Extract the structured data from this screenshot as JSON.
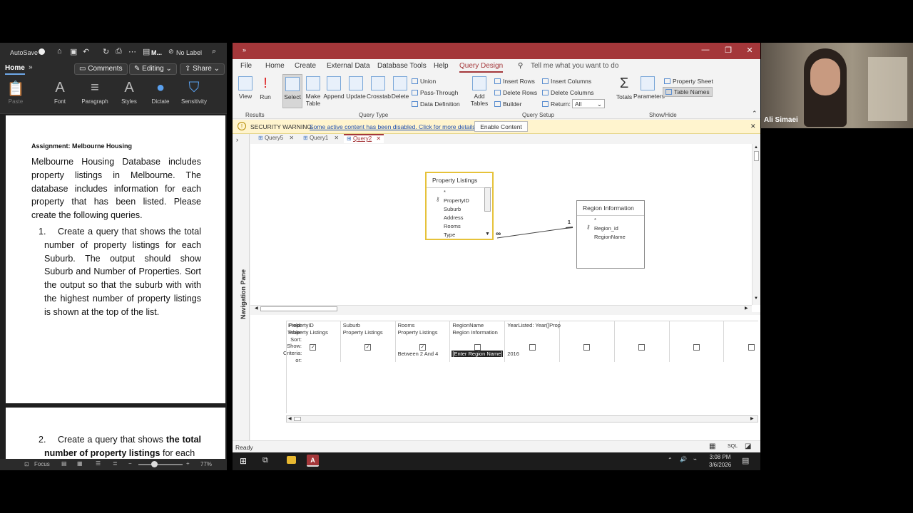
{
  "word": {
    "autosave": "AutoSave",
    "doc_short": "M...",
    "no_label": "No Label",
    "tab_home": "Home",
    "comments": "Comments",
    "editing": "Editing",
    "share": "Share",
    "ribbon": [
      "Paste",
      "Font",
      "Paragraph",
      "Styles",
      "Dictate",
      "Sensitivity"
    ],
    "doc": {
      "heading": "Assignment: Melbourne Housing",
      "intro": "Melbourne Housing Database includes property listings in Melbourne. The database includes information for each property that has been listed. Please create the following queries.",
      "item1_num": "1.",
      "item1_text": "Create a query that shows the total number of property listings for each Suburb. The output should show Suburb and Number of Properties. Sort the output so that the suburb with with the highest number of property listings is shown at the top of the list.",
      "item2_num": "2.",
      "item2_a": "Create a query that shows ",
      "item2_b": "the total number of property listings",
      "item2_c": " for each"
    },
    "status": {
      "focus": "Focus",
      "zoom": "77%"
    }
  },
  "access": {
    "menu": [
      "File",
      "Home",
      "Create",
      "External Data",
      "Database Tools",
      "Help",
      "Query Design"
    ],
    "active_menu": "Query Design",
    "tell_me": "Tell me what you want to do",
    "ribbon": {
      "view": "View",
      "run": "Run",
      "results_group": "Results",
      "select": "Select",
      "make_table": "Make Table",
      "append": "Append",
      "update": "Update",
      "crosstab": "Crosstab",
      "delete": "Delete",
      "union": "Union",
      "pass_through": "Pass-Through",
      "data_definition": "Data Definition",
      "query_type_group": "Query Type",
      "add_tables": "Add Tables",
      "insert_rows": "Insert Rows",
      "delete_rows": "Delete Rows",
      "builder": "Builder",
      "insert_columns": "Insert Columns",
      "delete_columns": "Delete Columns",
      "return_label": "Return:",
      "return_value": "All",
      "query_setup_group": "Query Setup",
      "totals": "Totals",
      "parameters": "Parameters",
      "property_sheet": "Property Sheet",
      "table_names": "Table Names",
      "show_hide_group": "Show/Hide"
    },
    "security": {
      "label": "SECURITY WARNING",
      "message": "Some active content has been disabled. Click for more details.",
      "button": "Enable Content"
    },
    "tabs": [
      "Query5",
      "Query1",
      "Query2"
    ],
    "active_tab": "Query2",
    "nav_pane": "Navigation Pane",
    "tables": [
      {
        "name": "Property Listings",
        "fields": [
          "*",
          "PropertyID",
          "Suburb",
          "Address",
          "Rooms",
          "Type"
        ]
      },
      {
        "name": "Region Information",
        "fields": [
          "*",
          "Region_id",
          "RegionName"
        ]
      }
    ],
    "relationship": {
      "one": "1",
      "many": "∞"
    },
    "grid": {
      "row_labels": [
        "Field:",
        "Table:",
        "Sort:",
        "Show:",
        "Criteria:",
        "or:"
      ],
      "columns": [
        {
          "field": "PropertyID",
          "table": "Property Listings",
          "show": true,
          "criteria": ""
        },
        {
          "field": "Suburb",
          "table": "Property Listings",
          "show": true,
          "criteria": ""
        },
        {
          "field": "Rooms",
          "table": "Property Listings",
          "show": true,
          "criteria": "Between 2 And 4"
        },
        {
          "field": "RegionName",
          "table": "Region Information",
          "show": false,
          "criteria": "[Enter Region Name]"
        },
        {
          "field": "YearListed: Year([Prop",
          "table": "",
          "show": false,
          "criteria": "2016"
        },
        {
          "field": "",
          "table": "",
          "show": false,
          "criteria": ""
        },
        {
          "field": "",
          "table": "",
          "show": false,
          "criteria": ""
        },
        {
          "field": "",
          "table": "",
          "show": false,
          "criteria": ""
        },
        {
          "field": "",
          "table": "",
          "show": false,
          "criteria": ""
        }
      ]
    },
    "status": "Ready",
    "status_sql": "SQL"
  },
  "webcam": {
    "name": "Ali Simaei"
  },
  "taskbar": {
    "time": "3:08 PM",
    "date": "3/6/2026"
  }
}
